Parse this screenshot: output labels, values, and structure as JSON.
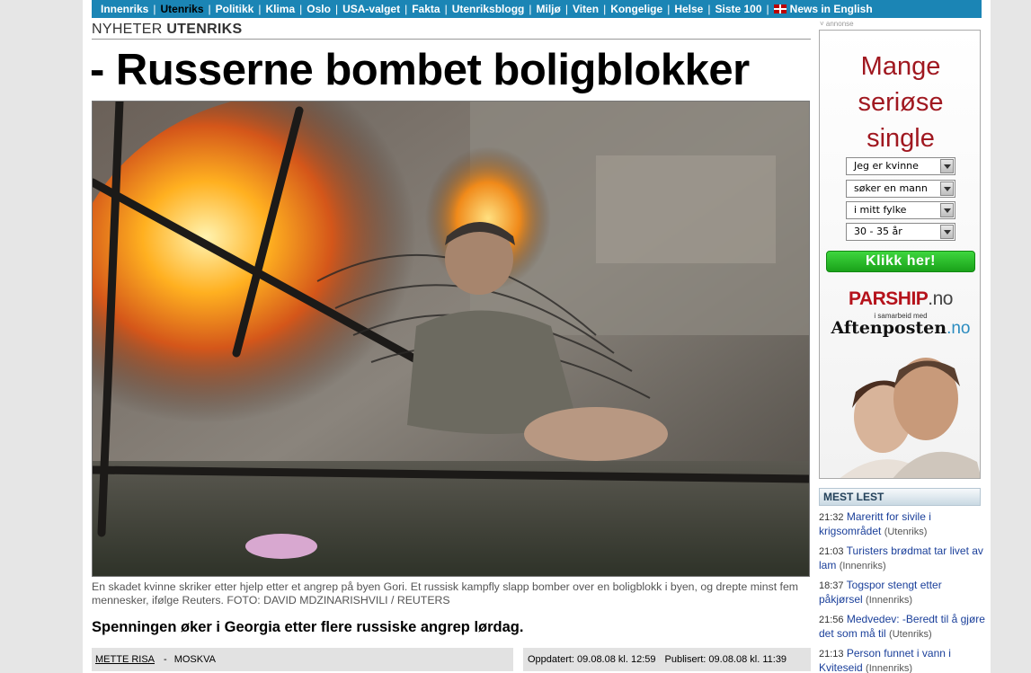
{
  "nav": {
    "items": [
      {
        "label": "Innenriks",
        "active": false
      },
      {
        "label": "Utenriks",
        "active": true
      },
      {
        "label": "Politikk",
        "active": false
      },
      {
        "label": "Klima",
        "active": false
      },
      {
        "label": "Oslo",
        "active": false
      },
      {
        "label": "USA-valget",
        "active": false
      },
      {
        "label": "Fakta",
        "active": false
      },
      {
        "label": "Utenriksblogg",
        "active": false
      },
      {
        "label": "Miljø",
        "active": false
      },
      {
        "label": "Viten",
        "active": false
      },
      {
        "label": "Kongelige",
        "active": false
      },
      {
        "label": "Helse",
        "active": false
      },
      {
        "label": "Siste 100",
        "active": false
      },
      {
        "label": "News in English",
        "active": false,
        "icon": "uk-flag-icon"
      }
    ]
  },
  "section": {
    "prefix": "NYHETER",
    "name": "UTENRIKS"
  },
  "article": {
    "headline": "- Russerne bombet boligblokker",
    "caption": "En skadet kvinne skriker etter hjelp etter et angrep på byen Gori. Et russisk kampfly slapp bomber over en boligblokk i byen, og drepte minst fem mennesker, ifølge Reuters. FOTO: DAVID MDZINARISHVILI / REUTERS",
    "lead": "Spenningen øker i Georgia etter flere russiske angrep lørdag.",
    "author": "METTE RISA",
    "location": "MOSKVA",
    "updated": "Oppdatert: 09.08.08 kl. 12:59",
    "published": "Publisert: 09.08.08 kl. 11:39"
  },
  "ad": {
    "label": "annonse",
    "title_lines": [
      "Mange",
      "seriøse",
      "single"
    ],
    "selects": [
      "Jeg er kvinne",
      "søker en mann",
      "i mitt fylke",
      "30 - 35 år"
    ],
    "button": "Klikk her!",
    "brand": "PARSHIP",
    "brand_tld": ".no",
    "partner_prefix": "i samarbeid med",
    "partner": "Aftenposten",
    "partner_tld": ".no"
  },
  "mest_lest": {
    "title": "MEST LEST",
    "items": [
      {
        "time": "21:32",
        "title": "Mareritt for sivile i krigsområdet",
        "category": "(Utenriks)"
      },
      {
        "time": "21:03",
        "title": "Turisters brødmat tar livet av lam",
        "category": "(Innenriks)"
      },
      {
        "time": "18:37",
        "title": "Togspor stengt etter påkjørsel",
        "category": "(Innenriks)"
      },
      {
        "time": "21:56",
        "title": "Medvedev: -Beredt til å gjøre det som må til",
        "category": "(Utenriks)"
      },
      {
        "time": "21:13",
        "title": "Person funnet i vann i Kviteseid",
        "category": "(Innenriks)"
      }
    ]
  },
  "colors": {
    "nav_bg": "#1b85b5",
    "ad_red": "#a01820",
    "link_blue": "#1a3f9a"
  }
}
